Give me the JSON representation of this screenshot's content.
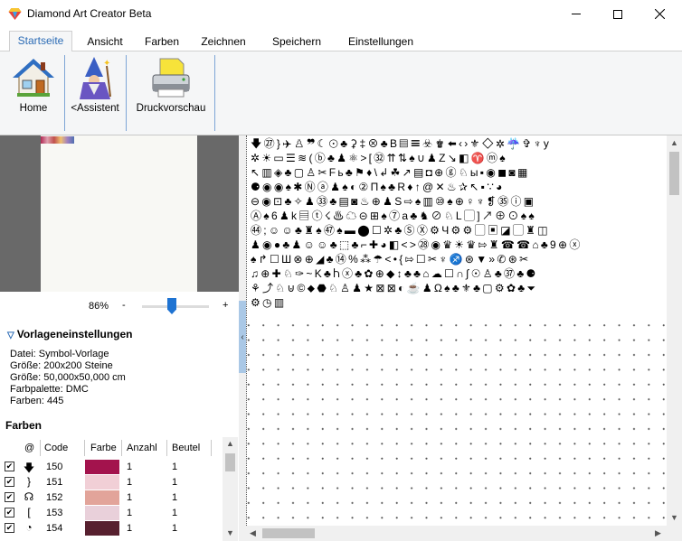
{
  "window": {
    "title": "Diamond Art Creator Beta"
  },
  "tabs": [
    {
      "label": "Startseite"
    },
    {
      "label": "Ansicht"
    },
    {
      "label": "Farben"
    },
    {
      "label": "Zeichnen"
    },
    {
      "label": "Speichern"
    },
    {
      "label": "Einstellungen"
    }
  ],
  "ribbon": {
    "home_label": "Home",
    "wizard_label": "<Assistent",
    "print_label": "Druckvorschau"
  },
  "zoom": {
    "value": "86%",
    "minus": "-",
    "plus": "+"
  },
  "template_settings": {
    "heading": "Vorlageneinstellungen",
    "lines": [
      "Datei: Symbol-Vorlage",
      "Größe: 200x200 Steine",
      "Größe: 50,000x50,000 cm",
      "Farbpalette: DMC",
      "Farben: 445"
    ]
  },
  "colors": {
    "heading": "Farben",
    "columns": {
      "symbol": "@",
      "code": "Code",
      "color": "Farbe",
      "count": "Anzahl",
      "bags": "Beutel"
    },
    "rows": [
      {
        "symbol": "🡇",
        "code": "150",
        "color": "#a3134d",
        "count": "1",
        "bags": "1"
      },
      {
        "symbol": "}",
        "code": "151",
        "color": "#f1cfd6",
        "count": "1",
        "bags": "1"
      },
      {
        "symbol": "☊",
        "code": "152",
        "color": "#e2a49a",
        "count": "1",
        "bags": "1"
      },
      {
        "symbol": "[",
        "code": "153",
        "color": "#e9d0da",
        "count": "1",
        "bags": "1"
      },
      {
        "symbol": "◔",
        "code": "154",
        "color": "#57202f",
        "count": "1",
        "bags": "1"
      }
    ]
  },
  "symbol_grid": {
    "rows": [
      "🡇㉗}✈♙❞☾☉♣⚳‡⊗♣B▤☰☣♚⬅‹›⚜◇✲☔✞♆y",
      "✲☀▭☰≋(ⓑ♣♟⚛>[㉜⇈⇅♠∪♟Z↘◧♈ⓜ♠",
      "↖▥◈♣▢♙✂Fь♣⚑♦\\↲☘↗▤◘⊕ⓖ♘ы▪◉◼◙▦",
      "⚈◉◉♠✱Ⓝⓐ♟♠◐②П♠♣R♦↑@✕♨✰↖▪∵◕",
      "⊖◉⊡♣✧♟㉝♣▤◙♨⊕♟S⇨♠▥⑩♠⊕♀♆❡㉟ⓘ▣",
      "Ⓐ♠6♟k▤ⓣ☇♨☁⊝⊞♠⑦a♣♞⊘♘L▢]↗⊕⊙♠♠",
      "㊹;☺☺♣♜♠㊼♠▬⬤☐✲♣ⓈⓍ⚙Ч⚙⚙▢▣◪▢♜◫",
      "♟◉●♣♟☺☺♣⬚♣⌐✚◕◧<>㉘◉♛☀♛⇰♜☎☎⌂♣9⊕ⓧ",
      "♠↱☐Ш⊗⊕◢♣⑭%⁂☂<•{⇰☐✂♆♐⊛▼»✆⊛✂",
      "♫⊕✚♘✑~K♣Ⴙⓧ♣✿⊕◆↕♣♣⌂☁☐∩∫☉♙♣㊲♣⚈",
      "⚘⤴♘⊍©⬥⬣♘♙♟★⊠⊠◐☕♟Ω♠♣⚜♣▢⚙✿♣⏷",
      "⚙◷▥"
    ]
  }
}
